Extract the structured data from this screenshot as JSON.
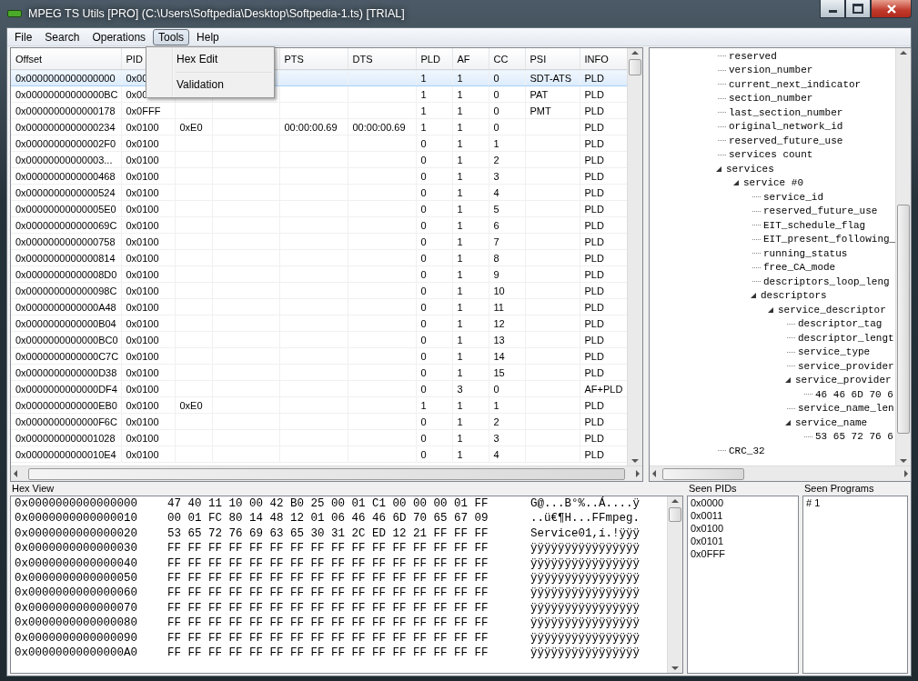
{
  "window": {
    "title": "MPEG TS Utils [PRO] (C:\\Users\\Softpedia\\Desktop\\Softpedia-1.ts) [TRIAL]"
  },
  "menu": [
    {
      "label": "File",
      "selected": false
    },
    {
      "label": "Search",
      "selected": false
    },
    {
      "label": "Operations",
      "selected": false
    },
    {
      "label": "Tools",
      "selected": true
    },
    {
      "label": "Help",
      "selected": false
    }
  ],
  "dropdown": {
    "items": [
      "Hex Edit",
      "Validation"
    ]
  },
  "table": {
    "columns": [
      "Offset",
      "PID",
      "",
      "",
      "PTS",
      "DTS",
      "PLD",
      "AF",
      "CC",
      "PSI",
      "INFO"
    ],
    "rows": [
      {
        "selected": true,
        "cells": [
          "0x0000000000000000",
          "0x00",
          "",
          "",
          "",
          "",
          "1",
          "1",
          "0",
          "SDT-ATS",
          "PLD"
        ]
      },
      {
        "selected": false,
        "cells": [
          "0x00000000000000BC",
          "0x00",
          "",
          "",
          "",
          "",
          "1",
          "1",
          "0",
          "PAT",
          "PLD"
        ]
      },
      {
        "selected": false,
        "cells": [
          "0x0000000000000178",
          "0x0FFF",
          "",
          "",
          "",
          "",
          "1",
          "1",
          "0",
          "PMT",
          "PLD"
        ]
      },
      {
        "selected": false,
        "cells": [
          "0x0000000000000234",
          "0x0100",
          "0xE0",
          "",
          "00:00:00.69",
          "00:00:00.69",
          "1",
          "1",
          "0",
          "",
          "PLD"
        ]
      },
      {
        "selected": false,
        "cells": [
          "0x00000000000002F0",
          "0x0100",
          "",
          "",
          "",
          "",
          "0",
          "1",
          "1",
          "",
          "PLD"
        ]
      },
      {
        "selected": false,
        "cells": [
          "0x00000000000003...",
          "0x0100",
          "",
          "",
          "",
          "",
          "0",
          "1",
          "2",
          "",
          "PLD"
        ]
      },
      {
        "selected": false,
        "cells": [
          "0x0000000000000468",
          "0x0100",
          "",
          "",
          "",
          "",
          "0",
          "1",
          "3",
          "",
          "PLD"
        ]
      },
      {
        "selected": false,
        "cells": [
          "0x0000000000000524",
          "0x0100",
          "",
          "",
          "",
          "",
          "0",
          "1",
          "4",
          "",
          "PLD"
        ]
      },
      {
        "selected": false,
        "cells": [
          "0x00000000000005E0",
          "0x0100",
          "",
          "",
          "",
          "",
          "0",
          "1",
          "5",
          "",
          "PLD"
        ]
      },
      {
        "selected": false,
        "cells": [
          "0x000000000000069C",
          "0x0100",
          "",
          "",
          "",
          "",
          "0",
          "1",
          "6",
          "",
          "PLD"
        ]
      },
      {
        "selected": false,
        "cells": [
          "0x0000000000000758",
          "0x0100",
          "",
          "",
          "",
          "",
          "0",
          "1",
          "7",
          "",
          "PLD"
        ]
      },
      {
        "selected": false,
        "cells": [
          "0x0000000000000814",
          "0x0100",
          "",
          "",
          "",
          "",
          "0",
          "1",
          "8",
          "",
          "PLD"
        ]
      },
      {
        "selected": false,
        "cells": [
          "0x00000000000008D0",
          "0x0100",
          "",
          "",
          "",
          "",
          "0",
          "1",
          "9",
          "",
          "PLD"
        ]
      },
      {
        "selected": false,
        "cells": [
          "0x000000000000098C",
          "0x0100",
          "",
          "",
          "",
          "",
          "0",
          "1",
          "10",
          "",
          "PLD"
        ]
      },
      {
        "selected": false,
        "cells": [
          "0x0000000000000A48",
          "0x0100",
          "",
          "",
          "",
          "",
          "0",
          "1",
          "11",
          "",
          "PLD"
        ]
      },
      {
        "selected": false,
        "cells": [
          "0x0000000000000B04",
          "0x0100",
          "",
          "",
          "",
          "",
          "0",
          "1",
          "12",
          "",
          "PLD"
        ]
      },
      {
        "selected": false,
        "cells": [
          "0x0000000000000BC0",
          "0x0100",
          "",
          "",
          "",
          "",
          "0",
          "1",
          "13",
          "",
          "PLD"
        ]
      },
      {
        "selected": false,
        "cells": [
          "0x0000000000000C7C",
          "0x0100",
          "",
          "",
          "",
          "",
          "0",
          "1",
          "14",
          "",
          "PLD"
        ]
      },
      {
        "selected": false,
        "cells": [
          "0x0000000000000D38",
          "0x0100",
          "",
          "",
          "",
          "",
          "0",
          "1",
          "15",
          "",
          "PLD"
        ]
      },
      {
        "selected": false,
        "cells": [
          "0x0000000000000DF4",
          "0x0100",
          "",
          "",
          "",
          "",
          "0",
          "3",
          "0",
          "",
          "AF+PLD"
        ]
      },
      {
        "selected": false,
        "cells": [
          "0x0000000000000EB0",
          "0x0100",
          "0xE0",
          "",
          "",
          "",
          "1",
          "1",
          "1",
          "",
          "PLD"
        ]
      },
      {
        "selected": false,
        "cells": [
          "0x0000000000000F6C",
          "0x0100",
          "",
          "",
          "",
          "",
          "0",
          "1",
          "2",
          "",
          "PLD"
        ]
      },
      {
        "selected": false,
        "cells": [
          "0x0000000000001028",
          "0x0100",
          "",
          "",
          "",
          "",
          "0",
          "1",
          "3",
          "",
          "PLD"
        ]
      },
      {
        "selected": false,
        "cells": [
          "0x00000000000010E4",
          "0x0100",
          "",
          "",
          "",
          "",
          "0",
          "1",
          "4",
          "",
          "PLD"
        ]
      }
    ]
  },
  "tree": {
    "items": [
      {
        "label": "reserved"
      },
      {
        "label": "version_number"
      },
      {
        "label": "current_next_indicator"
      },
      {
        "label": "section_number"
      },
      {
        "label": "last_section_number"
      },
      {
        "label": "original_network_id"
      },
      {
        "label": "reserved_future_use"
      },
      {
        "label": "services count"
      },
      {
        "label": "services",
        "expanded": true,
        "children": [
          {
            "label": "service #0",
            "expanded": true,
            "children": [
              {
                "label": "service_id"
              },
              {
                "label": "reserved_future_use"
              },
              {
                "label": "EIT_schedule_flag"
              },
              {
                "label": "EIT_present_following_"
              },
              {
                "label": "running_status"
              },
              {
                "label": "free_CA_mode"
              },
              {
                "label": "descriptors_loop_leng"
              },
              {
                "label": "descriptors",
                "expanded": true,
                "children": [
                  {
                    "label": "service_descriptor",
                    "expanded": true,
                    "children": [
                      {
                        "label": "descriptor_tag"
                      },
                      {
                        "label": "descriptor_lengt"
                      },
                      {
                        "label": "service_type"
                      },
                      {
                        "label": "service_provider"
                      },
                      {
                        "label": "service_provider",
                        "expanded": true,
                        "children": [
                          {
                            "label": "46 46 6D 70 6"
                          }
                        ]
                      },
                      {
                        "label": "service_name_len"
                      },
                      {
                        "label": "service_name",
                        "expanded": true,
                        "children": [
                          {
                            "label": "53 65 72 76 6"
                          }
                        ]
                      }
                    ]
                  }
                ]
              }
            ]
          }
        ]
      },
      {
        "label": "CRC_32"
      }
    ]
  },
  "hex_view": {
    "title": "Hex View",
    "rows": [
      {
        "offset": "0x0000000000000000",
        "bytes": "47 40 11 10 00 42 B0 25 00 01 C1 00 00 00 01 FF",
        "ascii": "G@...B°%..Á....ÿ"
      },
      {
        "offset": "0x0000000000000010",
        "bytes": "00 01 FC 80 14 48 12 01 06 46 46 6D 70 65 67 09",
        "ascii": "..ü€¶H...FFmpeg."
      },
      {
        "offset": "0x0000000000000020",
        "bytes": "53 65 72 76 69 63 65 30 31 2C ED 12 21 FF FF FF",
        "ascii": "Service01,í.!ÿÿÿ"
      },
      {
        "offset": "0x0000000000000030",
        "bytes": "FF FF FF FF FF FF FF FF FF FF FF FF FF FF FF FF",
        "ascii": "ÿÿÿÿÿÿÿÿÿÿÿÿÿÿÿÿ"
      },
      {
        "offset": "0x0000000000000040",
        "bytes": "FF FF FF FF FF FF FF FF FF FF FF FF FF FF FF FF",
        "ascii": "ÿÿÿÿÿÿÿÿÿÿÿÿÿÿÿÿ"
      },
      {
        "offset": "0x0000000000000050",
        "bytes": "FF FF FF FF FF FF FF FF FF FF FF FF FF FF FF FF",
        "ascii": "ÿÿÿÿÿÿÿÿÿÿÿÿÿÿÿÿ"
      },
      {
        "offset": "0x0000000000000060",
        "bytes": "FF FF FF FF FF FF FF FF FF FF FF FF FF FF FF FF",
        "ascii": "ÿÿÿÿÿÿÿÿÿÿÿÿÿÿÿÿ"
      },
      {
        "offset": "0x0000000000000070",
        "bytes": "FF FF FF FF FF FF FF FF FF FF FF FF FF FF FF FF",
        "ascii": "ÿÿÿÿÿÿÿÿÿÿÿÿÿÿÿÿ"
      },
      {
        "offset": "0x0000000000000080",
        "bytes": "FF FF FF FF FF FF FF FF FF FF FF FF FF FF FF FF",
        "ascii": "ÿÿÿÿÿÿÿÿÿÿÿÿÿÿÿÿ"
      },
      {
        "offset": "0x0000000000000090",
        "bytes": "FF FF FF FF FF FF FF FF FF FF FF FF FF FF FF FF",
        "ascii": "ÿÿÿÿÿÿÿÿÿÿÿÿÿÿÿÿ"
      },
      {
        "offset": "0x00000000000000A0",
        "bytes": "FF FF FF FF FF FF FF FF FF FF FF FF FF FF FF FF",
        "ascii": "ÿÿÿÿÿÿÿÿÿÿÿÿÿÿÿÿ"
      }
    ]
  },
  "seen_pids": {
    "title": "Seen PIDs",
    "items": [
      "0x0000",
      "0x0011",
      "0x0100",
      "0x0101",
      "0x0FFF"
    ]
  },
  "seen_programs": {
    "title": "Seen Programs",
    "items": [
      "# 1"
    ]
  }
}
